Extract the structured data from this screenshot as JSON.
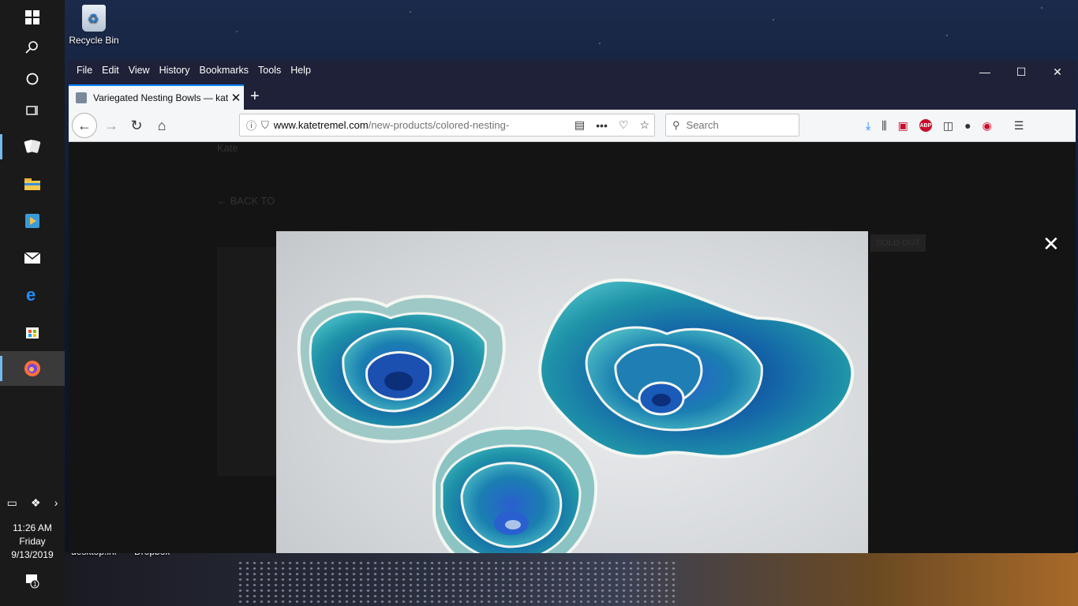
{
  "desktop": {
    "recycle_bin_label": "Recycle Bin",
    "file_labels": [
      "desktop.ini",
      "Dropbox"
    ]
  },
  "taskbar": {
    "clock_time": "11:26 AM",
    "clock_day": "Friday",
    "clock_date": "9/13/2019",
    "notification_count": "1"
  },
  "menubar": {
    "items": [
      "File",
      "Edit",
      "View",
      "History",
      "Bookmarks",
      "Tools",
      "Help"
    ]
  },
  "tab": {
    "title": "Variegated Nesting Bowls — kat"
  },
  "urlbar": {
    "host": "www.katetremel.com",
    "path": "/new-products/colored-nesting-"
  },
  "searchbar": {
    "placeholder": "Search"
  },
  "page": {
    "brand_text": "Kate",
    "back_link": "← BACK TO",
    "sold_out": "SOLD OUT"
  },
  "lightbox": {
    "close_glyph": "✕"
  },
  "colors": {
    "accent": "#0a84ff",
    "tab_bar": "#1e2137",
    "bowl_glaze": "#1a8ba0"
  }
}
